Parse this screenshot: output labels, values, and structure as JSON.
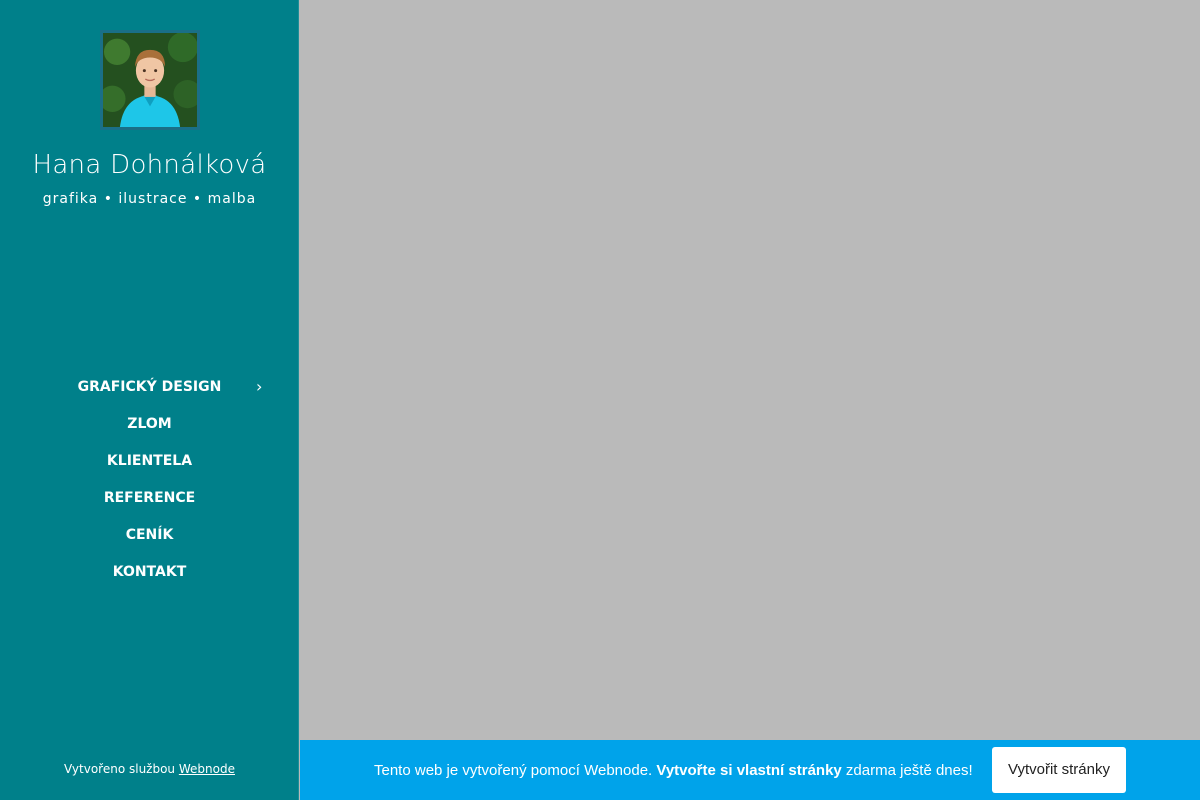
{
  "sidebar": {
    "site_name": "Hana Dohnálková",
    "slogan": "grafika • ilustrace • malba",
    "nav": [
      {
        "label": "GRAFICKÝ DESIGN",
        "has_submenu": true
      },
      {
        "label": "ZLOM"
      },
      {
        "label": "KLIENTELA"
      },
      {
        "label": "REFERENCE"
      },
      {
        "label": "CENÍK"
      },
      {
        "label": "KONTAKT"
      }
    ],
    "submenu_icon": "chevron-right-icon",
    "credit_prefix": "Vytvořeno službou ",
    "credit_link": "Webnode"
  },
  "banner": {
    "text_start": "Tento web je vytvořený pomocí Webnode. ",
    "text_bold": "Vytvořte si vlastní stránky",
    "text_end": " zdarma ještě dnes!",
    "button_label": "Vytvořit stránky"
  },
  "colors": {
    "sidebar_bg": "#00808a",
    "content_bg": "#bababa",
    "banner_bg": "#00a3ea",
    "text": "#ffffff"
  }
}
